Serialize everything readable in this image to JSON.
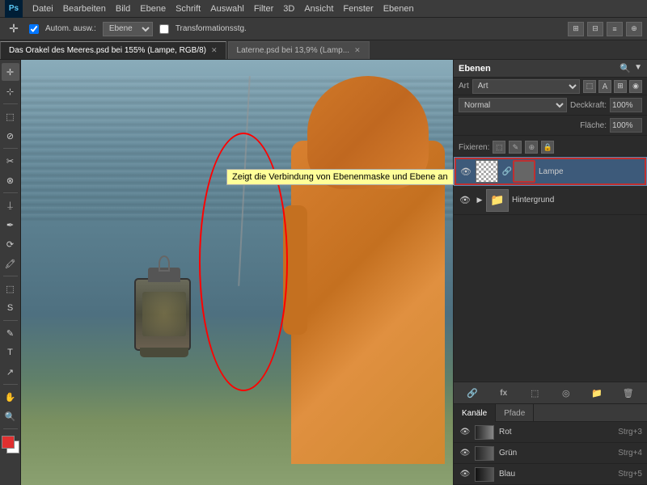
{
  "app": {
    "logo": "Ps",
    "title": "Adobe Photoshop"
  },
  "menu": {
    "items": [
      "Datei",
      "Bearbeiten",
      "Bild",
      "Ebene",
      "Schrift",
      "Auswahl",
      "Filter",
      "3D",
      "Ansicht",
      "Fenster",
      "Ebenen"
    ]
  },
  "options_bar": {
    "auto_select_label": "Autom. ausw.:",
    "layer_select": "Ebene",
    "transform_label": "Transformationsstg.",
    "icons": [
      "⊞",
      "⊟",
      "≡",
      "⊕"
    ]
  },
  "tabs": [
    {
      "label": "Das Orakel des Meeres.psd bei 155% (Lampe, RGB/8)",
      "active": true,
      "modified": true
    },
    {
      "label": "Laterne.psd bei 13,9% (Lamp...",
      "active": false,
      "modified": false
    }
  ],
  "toolbar": {
    "tools": [
      "↖",
      "⊹",
      "⬚",
      "⊘",
      "✂",
      "⊗",
      "⍊",
      "⊡",
      "✒",
      "⟳",
      "🖍",
      "⬚",
      "S",
      "✎",
      "T",
      "↗",
      "✋",
      "🔍"
    ]
  },
  "layers_panel": {
    "title": "Ebenen",
    "blend_mode": "Normal",
    "opacity_label": "Deckkraft:",
    "opacity_value": "100%",
    "fill_label": "Fläche:",
    "fill_value": "100%",
    "fixieren_label": "Fixieren:",
    "fix_icons": [
      "⬚",
      "✎",
      "⊕",
      "🔒"
    ],
    "layers": [
      {
        "name": "Lampe",
        "visible": true,
        "has_mask": true,
        "active": true,
        "chain_visible": true
      },
      {
        "name": "Hintergrund",
        "visible": true,
        "has_mask": false,
        "active": false,
        "is_folder": true
      }
    ],
    "bottom_icons": [
      "🔗",
      "fx",
      "⬚",
      "◎",
      "📁",
      "🗑"
    ],
    "tooltip": "Zeigt die Verbindung von Ebenenmaske und Ebene an"
  },
  "channels_panel": {
    "tabs": [
      "Kanäle",
      "Pfade"
    ],
    "active_tab": "Kanäle",
    "channels": [
      {
        "name": "Rot",
        "shortcut": "Strg+3",
        "color": "#888"
      },
      {
        "name": "Grün",
        "shortcut": "Strg+4",
        "color": "#666"
      },
      {
        "name": "Blau",
        "shortcut": "Strg+5",
        "color": "#555"
      }
    ]
  },
  "colors": {
    "bg_panel": "#2b2b2b",
    "bg_toolbar": "#3a3a3a",
    "active_layer": "#3d5a7a",
    "active_layer_border": "#5a8ab0",
    "tooltip_bg": "#ffff99",
    "red_oval": "#cc0000",
    "layer_active_border": "#c03030"
  }
}
